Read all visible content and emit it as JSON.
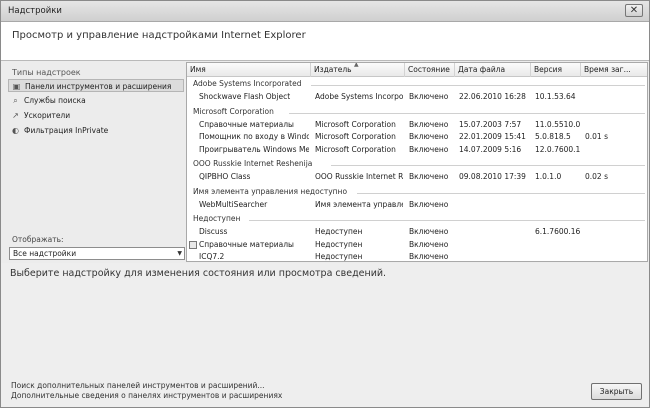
{
  "window": {
    "title": "Надстройки",
    "close_glyph": "✕"
  },
  "header": {
    "text": "Просмотр и управление надстройками Internet Explorer"
  },
  "left": {
    "group_label": "Типы надстроек",
    "types": [
      {
        "label": "Панели инструментов и расширения",
        "icon": "toolbar-icon",
        "glyph": "▣",
        "selected": true
      },
      {
        "label": "Службы поиска",
        "icon": "search-icon",
        "glyph": "⌕",
        "selected": false
      },
      {
        "label": "Ускорители",
        "icon": "accelerator-icon",
        "glyph": "↗",
        "selected": false
      },
      {
        "label": "Фильтрация InPrivate",
        "icon": "inprivate-icon",
        "glyph": "◐",
        "selected": false
      }
    ],
    "show_label": "Отображать:",
    "show_value": "Все надстройки",
    "dropdown_arrow": "▼"
  },
  "list": {
    "columns": [
      "Имя",
      "Издатель",
      "Состояние",
      "Дата файла",
      "Версия",
      "Время заг..."
    ],
    "groups": [
      {
        "name": "Adobe Systems Incorporated",
        "rows": [
          {
            "name": "Shockwave Flash Object",
            "publisher": "Adobe Systems Incorpor...",
            "state": "Включено",
            "date": "22.06.2010 16:28",
            "version": "10.1.53.64",
            "time": ""
          }
        ]
      },
      {
        "name": "Microsoft Corporation",
        "rows": [
          {
            "name": "Справочные материалы",
            "publisher": "Microsoft Corporation",
            "state": "Включено",
            "date": "15.07.2003 7:57",
            "version": "11.0.5510.0",
            "time": ""
          },
          {
            "name": "Помощник по входу в Windo...",
            "publisher": "Microsoft Corporation",
            "state": "Включено",
            "date": "22.01.2009 15:41",
            "version": "5.0.818.5",
            "time": "0.01 s"
          },
          {
            "name": "Проигрыватель Windows Media",
            "publisher": "Microsoft Corporation",
            "state": "Включено",
            "date": "14.07.2009 5:16",
            "version": "12.0.7600.1...",
            "time": ""
          }
        ]
      },
      {
        "name": "OOO Russkie Internet Reshenija",
        "rows": [
          {
            "name": "QIPBHO Class",
            "publisher": "OOO Russkie Internet Re...",
            "state": "Включено",
            "date": "09.08.2010 17:39",
            "version": "1.0.1.0",
            "time": "0.02 s"
          }
        ]
      },
      {
        "name": "Имя элемента управления недоступно",
        "rows": [
          {
            "name": "WebMultiSearcher",
            "publisher": "Имя элемента управле...",
            "state": "Включено",
            "date": "",
            "version": "",
            "time": ""
          }
        ]
      },
      {
        "name": "Недоступен",
        "rows": [
          {
            "name": "Discuss",
            "publisher": "Недоступен",
            "state": "Включено",
            "date": "",
            "version": "6.1.7600.16...",
            "time": ""
          },
          {
            "name": "Справочные материалы",
            "publisher": "Недоступен",
            "state": "Включено",
            "date": "",
            "version": "",
            "time": "",
            "icon": "reference-icon"
          },
          {
            "name": "ICQ7.2",
            "publisher": "Недоступен",
            "state": "Включено",
            "date": "",
            "version": "",
            "time": ""
          }
        ]
      }
    ]
  },
  "detail": {
    "text": "Выберите надстройку для изменения состояния или просмотра сведений."
  },
  "footer": {
    "link1": "Поиск дополнительных панелей инструментов и расширений...",
    "link2": "Дополнительные сведения о панелях инструментов и расширениях",
    "close_label": "Закрыть"
  }
}
